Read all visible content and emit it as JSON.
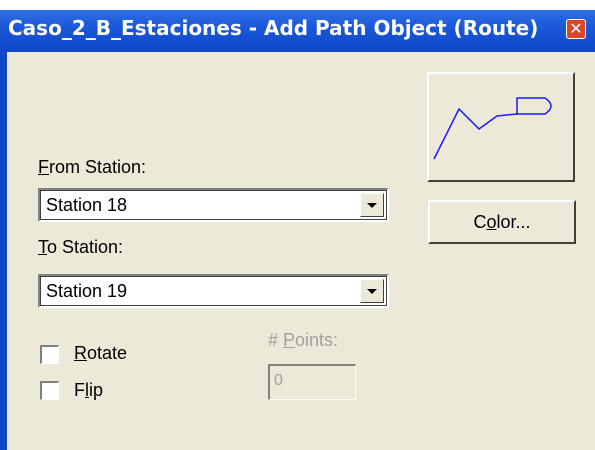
{
  "window": {
    "title": "Caso_2_B_Estaciones - Add Path Object (Route)",
    "close_glyph": "✕"
  },
  "from_station": {
    "label": "From Station:",
    "value": "Station 18"
  },
  "to_station": {
    "label": "To Station:",
    "value": "Station 19"
  },
  "options": {
    "rotate_label": "Rotate",
    "rotate_checked": false,
    "flip_label": "Flip",
    "flip_checked": false
  },
  "points": {
    "label": "# Points:",
    "value": "0"
  },
  "buttons": {
    "preview_icon": "route-preview-icon",
    "color_label": "Color..."
  },
  "colors": {
    "title_bar": "#1a56d8",
    "dialog_bg": "#ece9d8",
    "route_line": "#1a1aff",
    "close_button": "#d9472b"
  }
}
